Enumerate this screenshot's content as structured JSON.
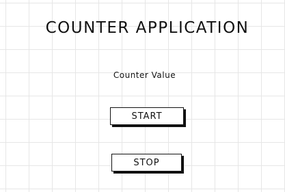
{
  "app": {
    "title": "COUNTER APPLICATION",
    "counter_label": "Counter Value"
  },
  "buttons": {
    "start_label": "START",
    "stop_label": "STOP"
  },
  "colors": {
    "background": "#ffffff",
    "grid": "#e6e6e6",
    "text": "#111111"
  }
}
